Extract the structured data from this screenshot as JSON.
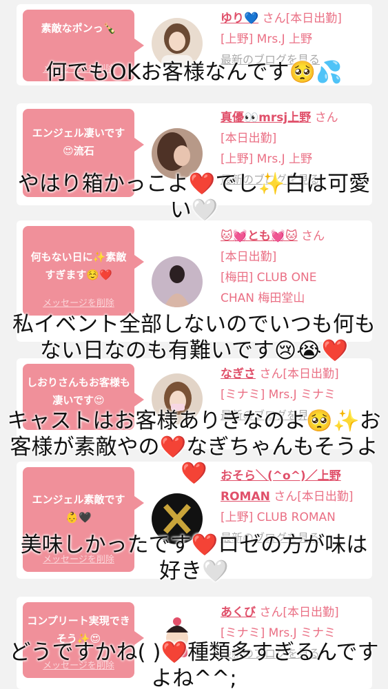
{
  "cards": [
    {
      "bubble": "素敵なポンっ🍾",
      "delete_label": "メッセージを削除",
      "name": "ゆり💙",
      "suffix": " さん[本日出勤]",
      "store": "[上野] Mrs.J 上野",
      "store2": "",
      "blog": "最新のブログを見る",
      "overlay": "何でもOKお客様なんです🥺💦"
    },
    {
      "bubble": "エンジェル凄いです😍流石",
      "delete_label": "",
      "name": "真優👀mrsj上野",
      "suffix": " さん",
      "status": "[本日出勤]",
      "store": "[上野] Mrs.J 上野",
      "blog": "最新のブログを見る",
      "overlay": "やはり箱かっこよ❤️でし✨白は可愛い🤍"
    },
    {
      "bubble": "何もない日に✨素敵すぎます☺️❤️",
      "delete_label": "メッセージを削除",
      "name": "🐱💓とも💓🐱",
      "suffix": " さん",
      "status": "[本日出勤]",
      "store": "[梅田] CLUB ONE",
      "store2": "CHAN 梅田堂山",
      "overlay": "私イベント全部しないのでいつも何もない日なのも有難いです😢😭❤️"
    },
    {
      "bubble": "しおりさんもお客様も凄いです😍",
      "delete_label": "",
      "name": "なぎさ",
      "suffix": " さん[本日出勤]",
      "store": "[ミナミ] Mrs.J ミナミ",
      "blog": "最新のブログを見る",
      "overlay": "キャストはお客様ありきなのよ🥺✨お客様が素敵やの❤️なぎちゃんもそうよ❤️"
    },
    {
      "bubble": "エンジェル素敵です👶🖤",
      "delete_label": "メッセージを削除",
      "name": "おそら＼(^o^)／上野ROMAN",
      "suffix": " さん[本日出勤]",
      "store": "[上野] CLUB ROMAN",
      "blog": "最新のブログを見る",
      "overlay": "美味しかったです❤️ロゼの方が味は好き🤍"
    },
    {
      "bubble": "コンプリート実現できそう✨😍",
      "delete_label": "メッセージを削除",
      "name": "あくび",
      "suffix": " さん[本日出勤]",
      "store": "[ミナミ] Mrs.J ミナミ",
      "blog": "最新のブログを見る",
      "overlay": "どうですかね(   )❤️種類多すぎるんですよね^^;"
    }
  ]
}
